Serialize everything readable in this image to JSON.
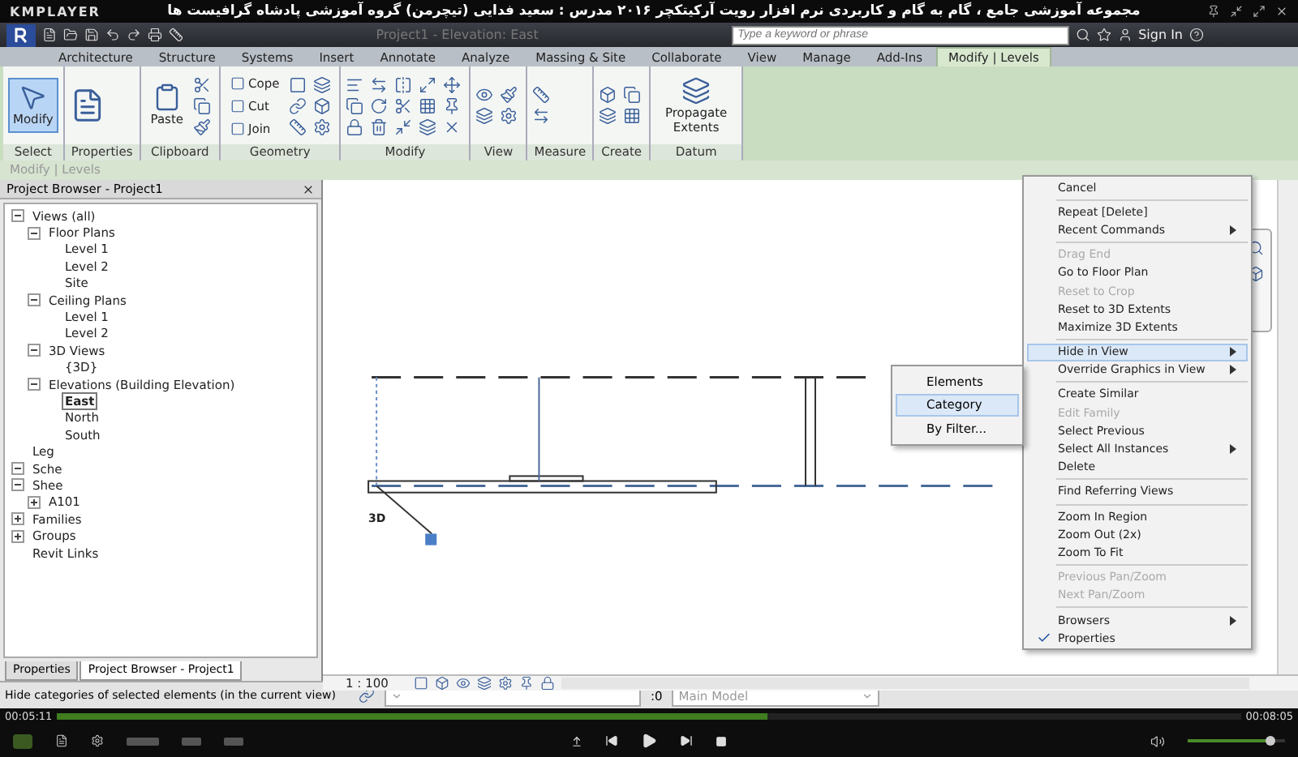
{
  "player": {
    "name": "KMPLAYER",
    "title": "مجموعه آموزشی جامع ، گام به گام و کاربردی نرم افزار رویت آرکیتکچر ۲۰۱۶  مدرس : سعید فدایی (تیچرمن) گروه آموزشی پادشاه گرافیست ها",
    "elapsed": "00:05:11",
    "total": "00:08:05",
    "progress": {
      "level": 0.6
    },
    "volume": {
      "level": 0.85
    }
  },
  "app": {
    "title": "Project1 - Elevation: East",
    "search_placeholder": "Type a keyword or phrase",
    "sign_in": "Sign In"
  },
  "ribbon_tabs": [
    {
      "label": "Architecture",
      "selected": false
    },
    {
      "label": "Structure",
      "selected": false
    },
    {
      "label": "Systems",
      "selected": false
    },
    {
      "label": "Insert",
      "selected": false
    },
    {
      "label": "Annotate",
      "selected": false
    },
    {
      "label": "Analyze",
      "selected": false
    },
    {
      "label": "Massing & Site",
      "selected": false
    },
    {
      "label": "Collaborate",
      "selected": false
    },
    {
      "label": "View",
      "selected": false
    },
    {
      "label": "Manage",
      "selected": false
    },
    {
      "label": "Add-Ins",
      "selected": false
    },
    {
      "label": "Modify | Levels",
      "selected": true
    }
  ],
  "ribbon_panels": [
    {
      "label": "Select",
      "tools": [
        {
          "label": "Modify",
          "kind": "large",
          "selected": true
        }
      ]
    },
    {
      "label": "Properties"
    },
    {
      "label": "Clipboard",
      "tools": [
        {
          "label": "Paste",
          "kind": "large",
          "selected": false
        }
      ]
    },
    {
      "label": "Geometry",
      "tools": [
        {
          "label": "Cope",
          "kind": "small",
          "selected": false
        },
        {
          "label": "Cut",
          "kind": "small",
          "selected": false
        },
        {
          "label": "Join",
          "kind": "small",
          "selected": false
        }
      ]
    },
    {
      "label": "Modify"
    },
    {
      "label": "View"
    },
    {
      "label": "Measure"
    },
    {
      "label": "Create"
    },
    {
      "label": "Datum",
      "tools": [
        {
          "label": "Propagate Extents",
          "kind": "large",
          "selected": false
        }
      ]
    }
  ],
  "options_bar": "Modify | Levels",
  "project_browser": {
    "title": "Project Browser - Project1",
    "tree": [
      {
        "label": "Views (all)",
        "expanded": true,
        "selected": false,
        "children": [
          {
            "label": "Floor Plans",
            "expanded": true,
            "selected": false,
            "children": [
              {
                "label": "Level 1",
                "selected": false
              },
              {
                "label": "Level 2",
                "selected": false
              },
              {
                "label": "Site",
                "selected": false
              }
            ]
          },
          {
            "label": "Ceiling Plans",
            "expanded": true,
            "selected": false,
            "children": [
              {
                "label": "Level 1",
                "selected": false
              },
              {
                "label": "Level 2",
                "selected": false
              }
            ]
          },
          {
            "label": "3D Views",
            "expanded": true,
            "selected": false,
            "children": [
              {
                "label": "{3D}",
                "selected": false
              }
            ]
          },
          {
            "label": "Elevations (Building Elevation)",
            "expanded": true,
            "selected": false,
            "children": [
              {
                "label": "East",
                "selected": true
              },
              {
                "label": "North",
                "selected": false
              },
              {
                "label": "South",
                "selected": false
              }
            ]
          }
        ]
      },
      {
        "label": "Leg",
        "selected": false
      },
      {
        "label": "Sche",
        "expanded": true,
        "selected": false
      },
      {
        "label": "Shee",
        "expanded": true,
        "selected": false,
        "children": [
          {
            "label": "A101",
            "expanded": false,
            "selected": false
          }
        ]
      },
      {
        "label": "Families",
        "expanded": false,
        "selected": false
      },
      {
        "label": "Groups",
        "expanded": false,
        "selected": false
      },
      {
        "label": "Revit Links",
        "selected": false
      }
    ]
  },
  "panel_tabs": [
    {
      "label": "Properties",
      "selected": false
    },
    {
      "label": "Project Browser - Project1",
      "selected": true
    }
  ],
  "canvas": {
    "view_label": "3D",
    "scale": "1 : 100"
  },
  "context_menu": [
    {
      "kind": "item",
      "label": "Cancel",
      "disabled": false,
      "selected": false,
      "checked": false,
      "submenu": false
    },
    {
      "kind": "separator"
    },
    {
      "kind": "item",
      "label": "Repeat [Delete]",
      "disabled": false,
      "selected": false,
      "checked": false,
      "submenu": false
    },
    {
      "kind": "item",
      "label": "Recent Commands",
      "disabled": false,
      "selected": false,
      "checked": false,
      "submenu": true
    },
    {
      "kind": "separator"
    },
    {
      "kind": "item",
      "label": "Drag End",
      "disabled": true,
      "selected": false,
      "checked": false,
      "submenu": false
    },
    {
      "kind": "item",
      "label": "Go to Floor Plan",
      "disabled": false,
      "selected": false,
      "checked": false,
      "submenu": false
    },
    {
      "kind": "item",
      "label": "Reset to Crop",
      "disabled": true,
      "selected": false,
      "checked": false,
      "submenu": false
    },
    {
      "kind": "item",
      "label": "Reset to 3D Extents",
      "disabled": false,
      "selected": false,
      "checked": false,
      "submenu": false
    },
    {
      "kind": "item",
      "label": "Maximize 3D Extents",
      "disabled": false,
      "selected": false,
      "checked": false,
      "submenu": false
    },
    {
      "kind": "separator"
    },
    {
      "kind": "item",
      "label": "Hide in View",
      "disabled": false,
      "selected": true,
      "checked": false,
      "submenu": true
    },
    {
      "kind": "item",
      "label": "Override Graphics in View",
      "disabled": false,
      "selected": false,
      "checked": false,
      "submenu": true
    },
    {
      "kind": "separator"
    },
    {
      "kind": "item",
      "label": "Create Similar",
      "disabled": false,
      "selected": false,
      "checked": false,
      "submenu": false
    },
    {
      "kind": "item",
      "label": "Edit Family",
      "disabled": true,
      "selected": false,
      "checked": false,
      "submenu": false
    },
    {
      "kind": "item",
      "label": "Select Previous",
      "disabled": false,
      "selected": false,
      "checked": false,
      "submenu": false
    },
    {
      "kind": "item",
      "label": "Select All Instances",
      "disabled": false,
      "selected": false,
      "checked": false,
      "submenu": true
    },
    {
      "kind": "item",
      "label": "Delete",
      "disabled": false,
      "selected": false,
      "checked": false,
      "submenu": false
    },
    {
      "kind": "separator"
    },
    {
      "kind": "item",
      "label": "Find Referring Views",
      "disabled": false,
      "selected": false,
      "checked": false,
      "submenu": false
    },
    {
      "kind": "separator"
    },
    {
      "kind": "item",
      "label": "Zoom In Region",
      "disabled": false,
      "selected": false,
      "checked": false,
      "submenu": false
    },
    {
      "kind": "item",
      "label": "Zoom Out (2x)",
      "disabled": false,
      "selected": false,
      "checked": false,
      "submenu": false
    },
    {
      "kind": "item",
      "label": "Zoom To Fit",
      "disabled": false,
      "selected": false,
      "checked": false,
      "submenu": false
    },
    {
      "kind": "separator"
    },
    {
      "kind": "item",
      "label": "Previous Pan/Zoom",
      "disabled": true,
      "selected": false,
      "checked": false,
      "submenu": false
    },
    {
      "kind": "item",
      "label": "Next Pan/Zoom",
      "disabled": true,
      "selected": false,
      "checked": false,
      "submenu": false
    },
    {
      "kind": "separator"
    },
    {
      "kind": "item",
      "label": "Browsers",
      "disabled": false,
      "selected": false,
      "checked": false,
      "submenu": true
    },
    {
      "kind": "item",
      "label": "Properties",
      "disabled": false,
      "selected": false,
      "checked": true,
      "submenu": false
    }
  ],
  "submenu": [
    {
      "label": "Elements",
      "selected": false
    },
    {
      "label": "Category",
      "selected": true
    },
    {
      "label": "By Filter...",
      "selected": false
    }
  ],
  "status_bar": {
    "message": "Hide categories of selected elements (in the current view)",
    "count": ":0",
    "model": "Main Model"
  }
}
